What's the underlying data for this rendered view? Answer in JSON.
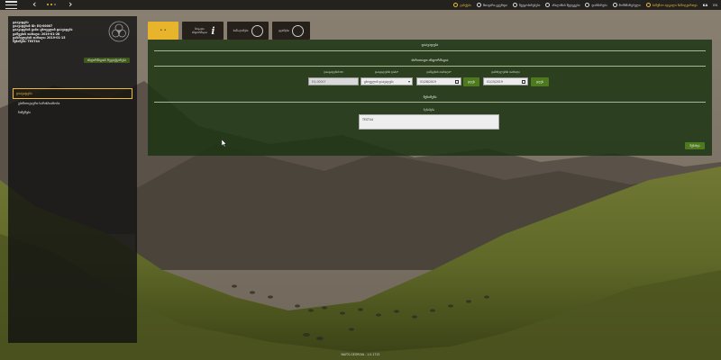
{
  "topbar": {
    "links": [
      {
        "label": "ტასქები",
        "icon": "bell-icon",
        "accent": true
      },
      {
        "label": "მთავარი გვერდი",
        "icon": "home-icon",
        "accent": false
      },
      {
        "label": "შეტყობინებები",
        "icon": "message-icon",
        "accent": false
      },
      {
        "label": "ანალიზის შედეგები",
        "icon": "clock-icon",
        "accent": false
      },
      {
        "label": "დახმარება",
        "icon": "help-icon",
        "accent": false
      },
      {
        "label": "მომხმარებელი",
        "icon": "user-icon",
        "accent": false
      },
      {
        "label": "სამუშაო ადგილი ჩამოტვირთვა",
        "icon": "location-icon",
        "accent": true
      }
    ],
    "lang_ka": "KA",
    "lang_en": "EN",
    "dot_colors": [
      "#f0b93a",
      "#f0b93a",
      "#7a7a7a"
    ]
  },
  "sidebar": {
    "info_lines": [
      "დაავადება",
      "დაავადების ID: EQ-00007",
      "დაავადების ტიპი: ცხოველის დაავადება",
      "დაწყების თარიღი: 2019-01-28",
      "დასრულების თარიღი: 2019-01-15",
      "შენიშვნა: TEST44"
    ],
    "edit_link": "ინფორმაციის რედაქტირება",
    "menu": [
      {
        "label": "დაავადება",
        "active": true
      },
      {
        "label": "ეპიზოოტიური ხარისხიანობა",
        "active": false
      },
      {
        "label": "ნიმუშები",
        "active": false
      }
    ]
  },
  "toolbar": {
    "buttons": [
      {
        "label": "• •",
        "icon": "dots-icon"
      },
      {
        "label": "ზოგადი ინფორმაცია",
        "icon": "info-icon"
      },
      {
        "label": "სიმპ-ტომები",
        "icon": "virus-icon"
      },
      {
        "label": "ფერმები",
        "icon": "farm-icon"
      }
    ]
  },
  "panel": {
    "title": "დაავადება",
    "section_general": "ძირითადი ინფორმაცია",
    "fields": {
      "id_label": "დაავადების ID",
      "id_value": "EQ-00007",
      "type_label": "დაავადების ტიპი*",
      "type_value": "ცხოველის დაავადება",
      "start_label": "დაწყების თარიღი*",
      "start_value": "01/28/2019",
      "end_label": "დასრულების თარიღი",
      "end_value": "01/15/2019"
    },
    "today_button": "დღეს",
    "section_comment": "შენიშვნა",
    "comment_label": "შენიშვნა",
    "comment_value": "TEST44",
    "save_button": "შენახვა"
  },
  "footer": "NAITS-GEORGIA - 1.0.1715",
  "colors": {
    "accent": "#f0b93a",
    "panel_green": "#1c3412",
    "button_green": "#4e7a1f"
  }
}
